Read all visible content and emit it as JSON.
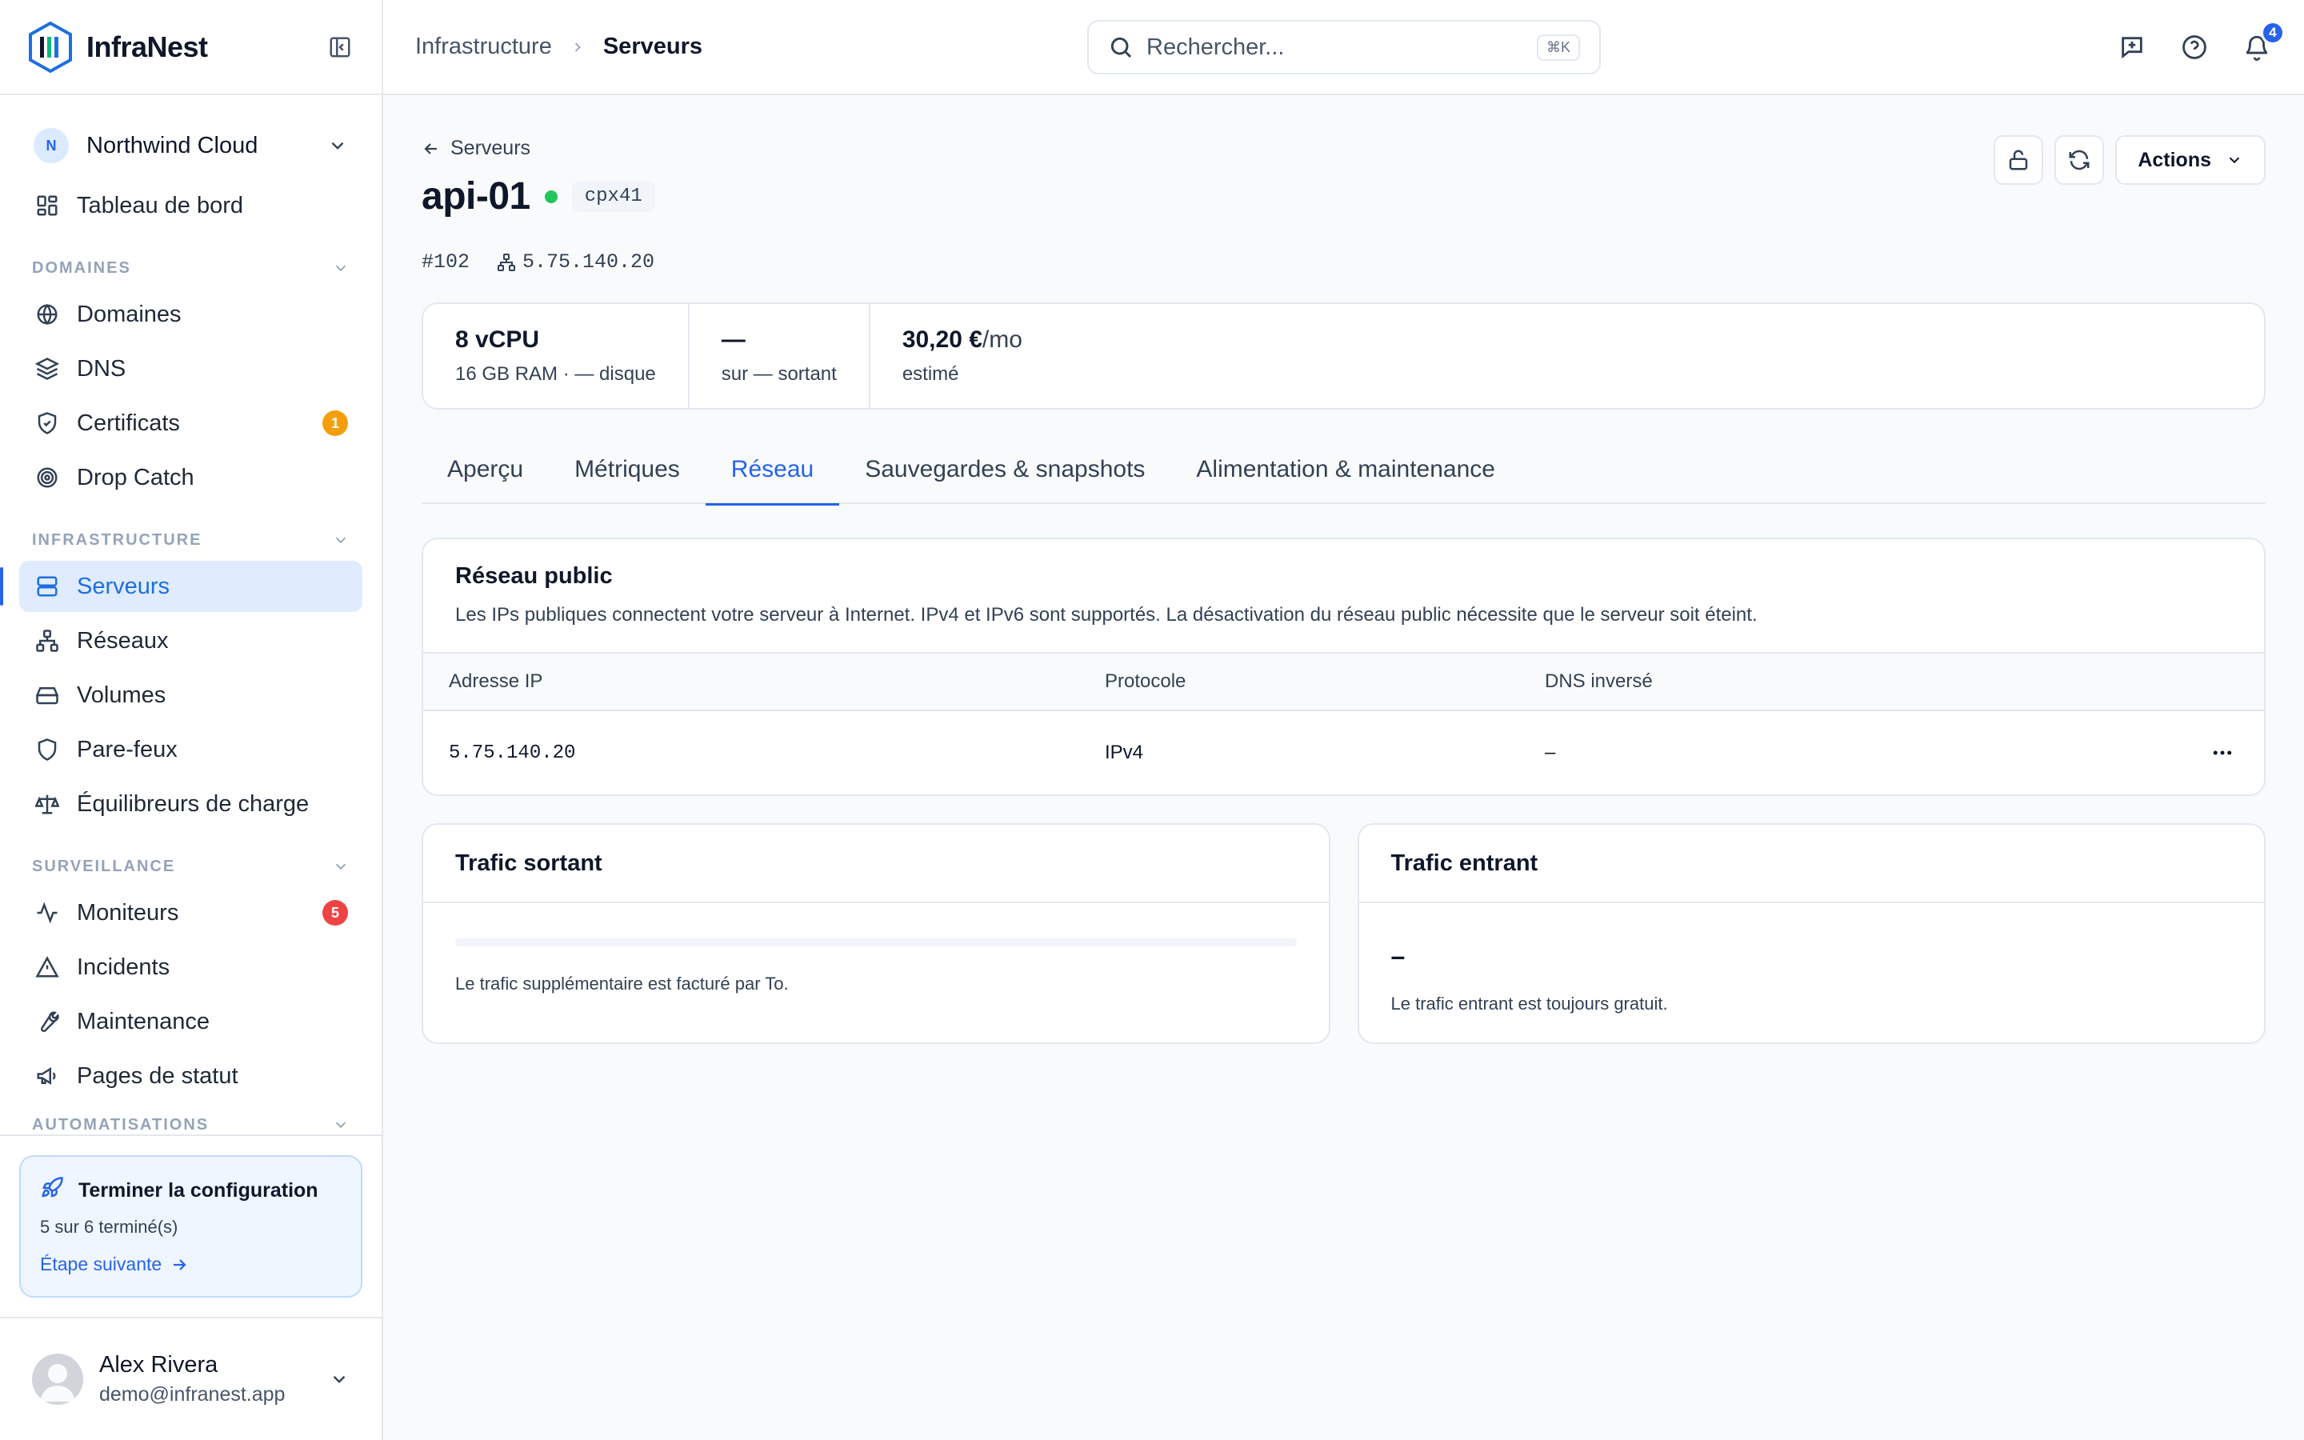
{
  "app": {
    "name": "InfraNest"
  },
  "sidebar": {
    "org": {
      "initial": "N",
      "name": "Northwind Cloud"
    },
    "dashboard": "Tableau de bord",
    "sections": {
      "domains": "DOMAINES",
      "infrastructure": "INFRASTRUCTURE",
      "monitoring": "SURVEILLANCE",
      "automation": "AUTOMATISATIONS"
    },
    "items": {
      "domaines": "Domaines",
      "dns": "DNS",
      "certificats": "Certificats",
      "certificats_badge": "1",
      "drop_catch": "Drop Catch",
      "serveurs": "Serveurs",
      "reseaux": "Réseaux",
      "volumes": "Volumes",
      "pare_feux": "Pare-feux",
      "equilibreurs": "Équilibreurs de charge",
      "moniteurs": "Moniteurs",
      "moniteurs_badge": "5",
      "incidents": "Incidents",
      "maintenance": "Maintenance",
      "pages_statut": "Pages de statut"
    },
    "setup": {
      "title": "Terminer la configuration",
      "progress": "5 sur 6 terminé(s)",
      "next": "Étape suivante"
    },
    "user": {
      "name": "Alex Rivera",
      "email": "demo@infranest.app"
    }
  },
  "topbar": {
    "breadcrumb": [
      "Infrastructure",
      "Serveurs"
    ],
    "search_placeholder": "Rechercher...",
    "search_shortcut": "⌘K",
    "notifications_count": "4"
  },
  "server": {
    "back_label": "Serveurs",
    "name": "api-01",
    "status_color": "#22c55e",
    "type": "cpx41",
    "id": "#102",
    "ip": "5.75.140.20",
    "actions_label": "Actions",
    "stats": [
      {
        "main": "8 vCPU",
        "unit": "",
        "sub": "16 GB RAM · — disque"
      },
      {
        "main": "—",
        "unit": "",
        "sub": "sur — sortant"
      },
      {
        "main": "30,20 €",
        "unit": "/mo",
        "sub": "estimé"
      }
    ]
  },
  "tabs": [
    "Aperçu",
    "Métriques",
    "Réseau",
    "Sauvegardes & snapshots",
    "Alimentation & maintenance"
  ],
  "active_tab": "Réseau",
  "public_network": {
    "title": "Réseau public",
    "description": "Les IPs publiques connectent votre serveur à Internet. IPv4 et IPv6 sont supportés. La désactivation du réseau public nécessite que le serveur soit éteint.",
    "columns": [
      "Adresse IP",
      "Protocole",
      "DNS inversé"
    ],
    "rows": [
      {
        "ip": "5.75.140.20",
        "protocol": "IPv4",
        "rdns": "–"
      }
    ]
  },
  "traffic": {
    "outgoing": {
      "title": "Trafic sortant",
      "usage_fraction": 0,
      "note": "Le trafic supplémentaire est facturé par To."
    },
    "incoming": {
      "title": "Trafic entrant",
      "value": "–",
      "note": "Le trafic entrant est toujours gratuit."
    }
  },
  "colors": {
    "accent": "#2563eb",
    "warning": "#f59e0b",
    "danger": "#ef4444"
  }
}
